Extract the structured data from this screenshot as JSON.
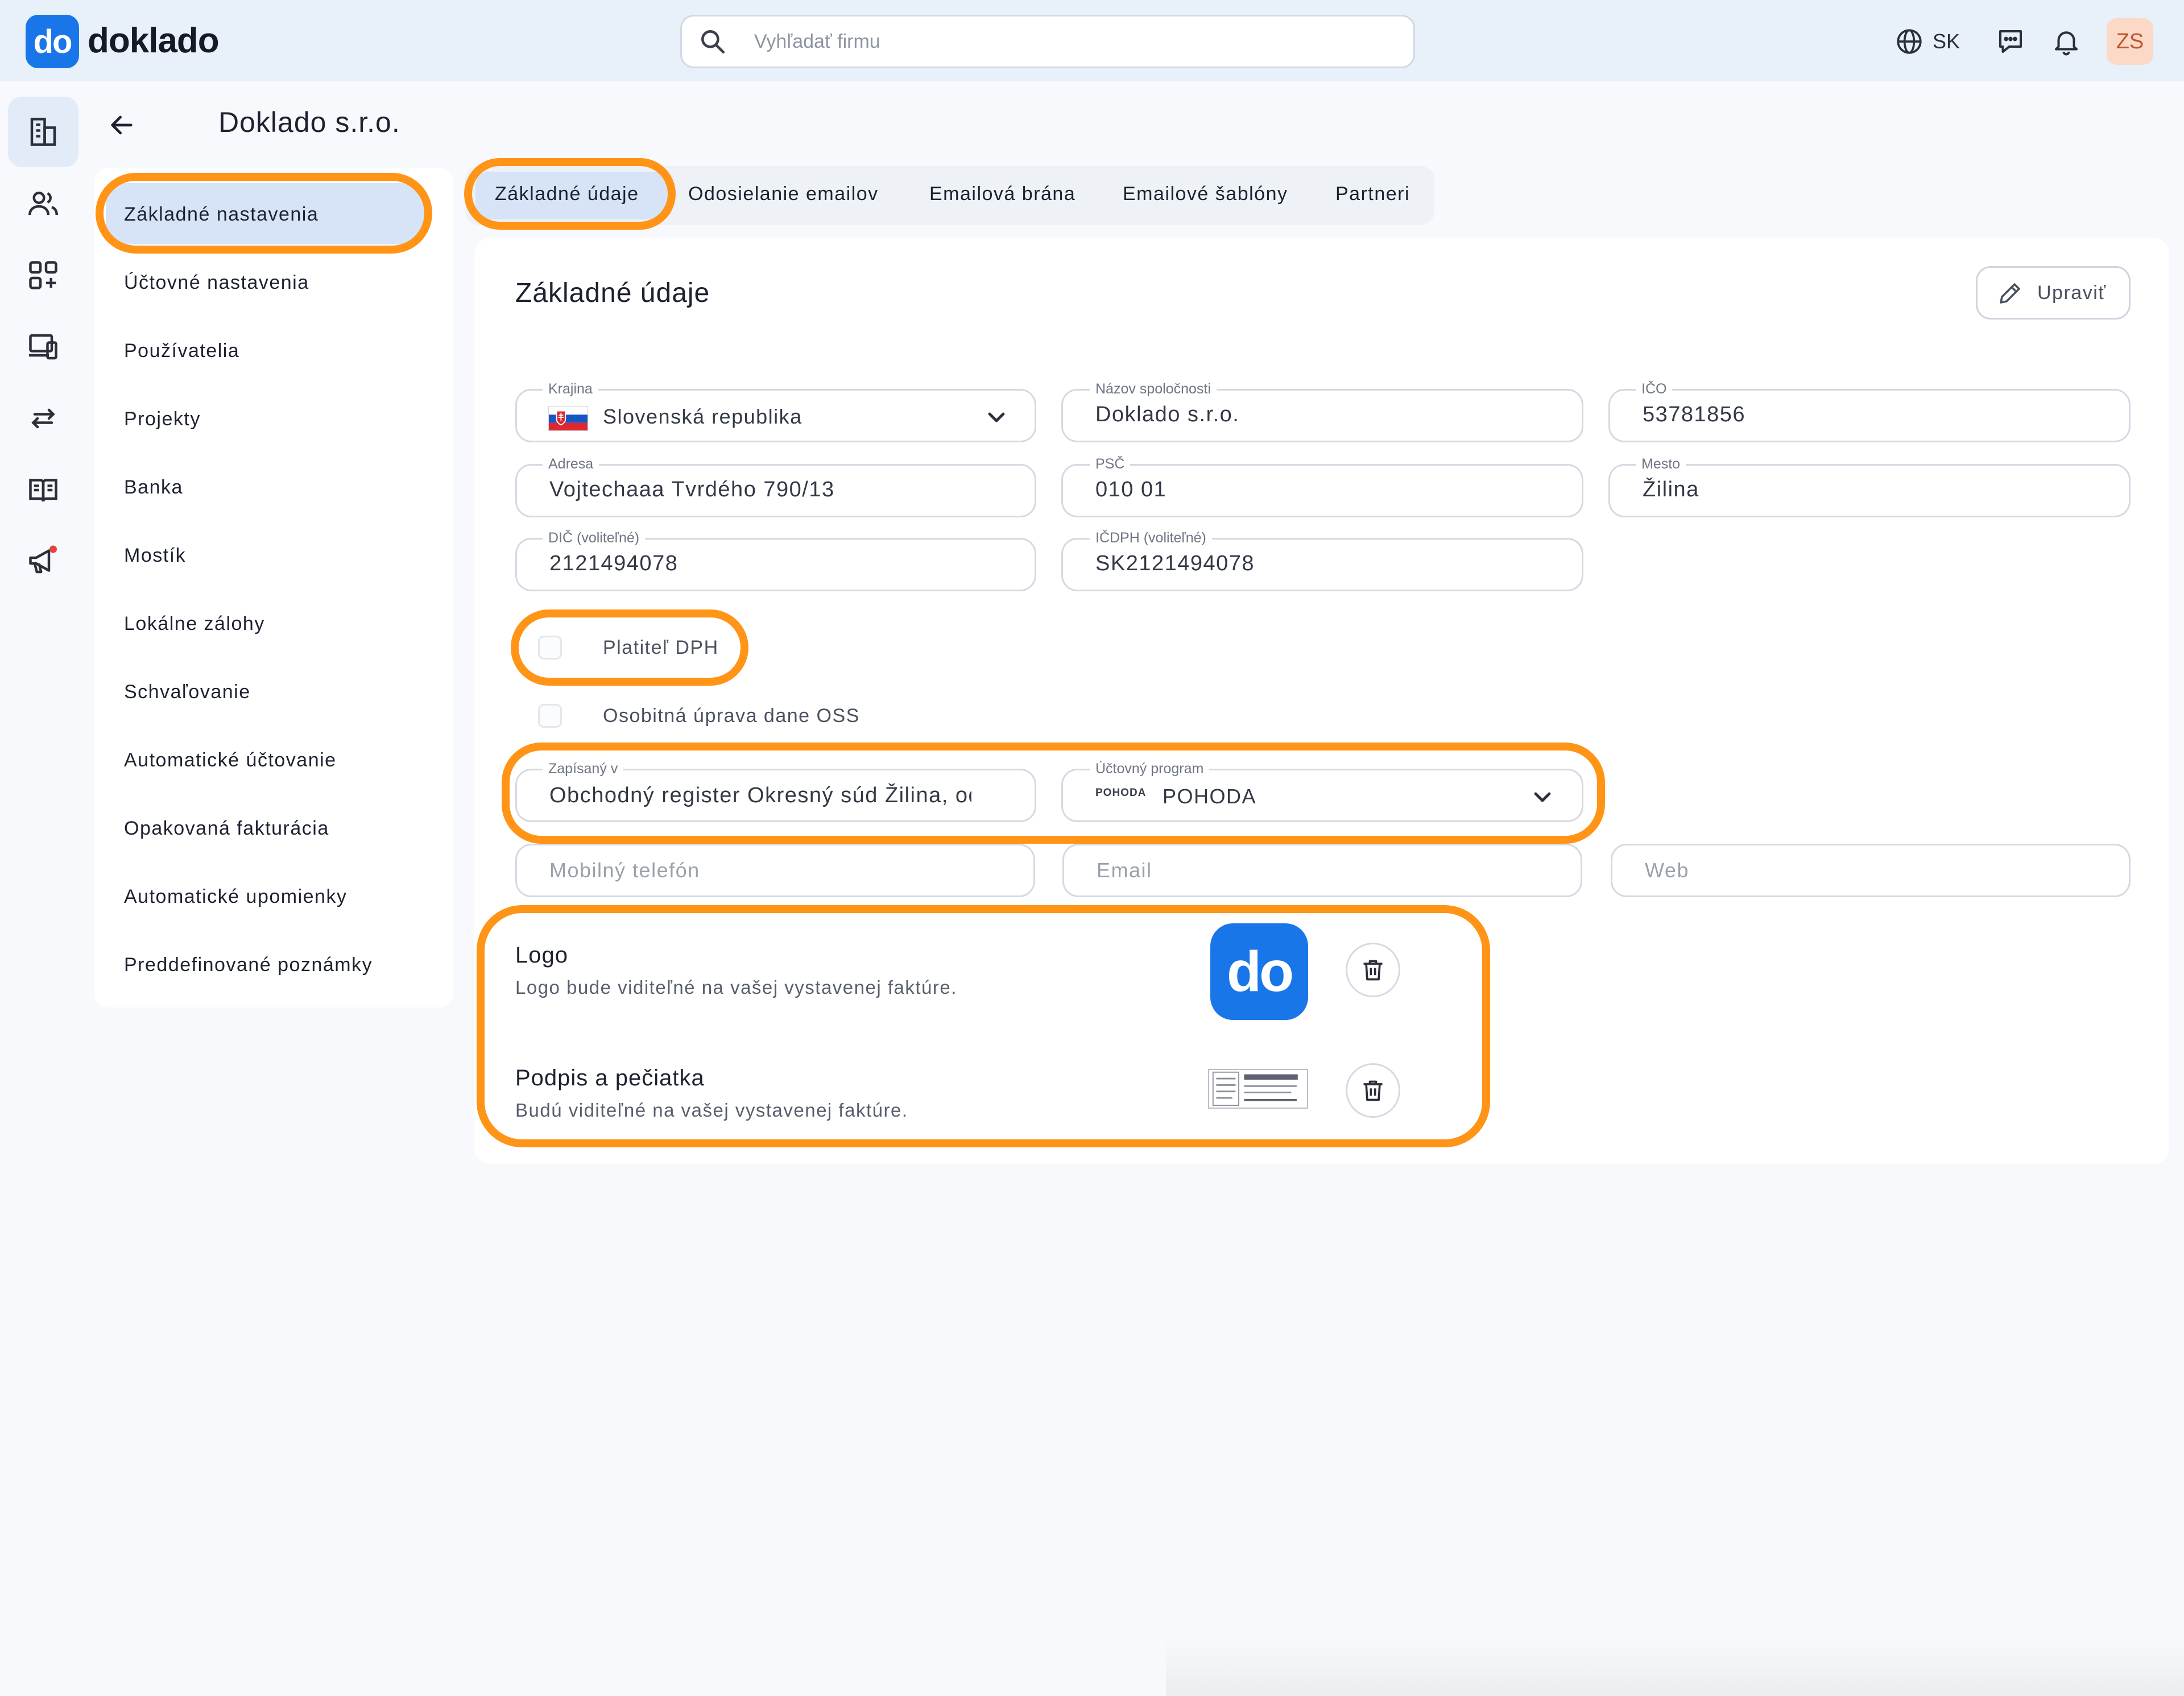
{
  "brand": {
    "badge": "do",
    "name": "doklado",
    "color": "#1976e8"
  },
  "search": {
    "placeholder": "Vyhľadať firmu"
  },
  "topbar": {
    "language": "SK",
    "avatar_initials": "ZS"
  },
  "rail": {
    "items": [
      "company-icon",
      "users-icon",
      "apps-icon",
      "devices-icon",
      "transfer-icon",
      "book-icon",
      "megaphone-icon"
    ]
  },
  "page": {
    "title": "Doklado s.r.o."
  },
  "sidebar": {
    "items": [
      {
        "label": "Základné nastavenia",
        "active": true
      },
      {
        "label": "Účtovné nastavenia"
      },
      {
        "label": "Používatelia"
      },
      {
        "label": "Projekty"
      },
      {
        "label": "Banka"
      },
      {
        "label": "Mostík"
      },
      {
        "label": "Lokálne zálohy"
      },
      {
        "label": "Schvaľovanie"
      },
      {
        "label": "Automatické účtovanie"
      },
      {
        "label": "Opakovaná fakturácia"
      },
      {
        "label": "Automatické upomienky"
      },
      {
        "label": "Preddefinované poznámky"
      }
    ]
  },
  "tabs": [
    {
      "label": "Základné údaje",
      "active": true
    },
    {
      "label": "Odosielanie emailov"
    },
    {
      "label": "Emailová brána"
    },
    {
      "label": "Emailové šablóny"
    },
    {
      "label": "Partneri"
    }
  ],
  "section": {
    "title": "Základné údaje",
    "edit_label": "Upraviť"
  },
  "form": {
    "country": {
      "label": "Krajina",
      "value": "Slovenská republika"
    },
    "company_name": {
      "label": "Názov spoločnosti",
      "value": "Doklado s.r.o."
    },
    "ico": {
      "label": "IČO",
      "value": "53781856"
    },
    "address": {
      "label": "Adresa",
      "value": "Vojtechaaa Tvrdého 790/13"
    },
    "psc": {
      "label": "PSČ",
      "value": "010 01"
    },
    "city": {
      "label": "Mesto",
      "value": "Žilina"
    },
    "dic": {
      "label": "DIČ (voliteľné)",
      "value": "2121494078"
    },
    "icdph": {
      "label": "IČDPH (voliteľné)",
      "value": "SK2121494078"
    },
    "vat_payer": {
      "label": "Platiteľ DPH",
      "checked": false
    },
    "oss": {
      "label": "Osobitná úprava dane OSS",
      "checked": false
    },
    "registered_in": {
      "label": "Zapísaný v",
      "value": "Obchodný register Okresný súd Žilina, oddiel: Sro"
    },
    "accounting_program": {
      "label": "Účtovný program",
      "value": "POHODA",
      "logo_text": "POHODA"
    },
    "mobile": {
      "placeholder": "Mobilný telefón"
    },
    "email": {
      "placeholder": "Email"
    },
    "web": {
      "placeholder": "Web"
    }
  },
  "assets": {
    "logo": {
      "title": "Logo",
      "subtitle": "Logo bude viditeľné na vašej vystavenej faktúre.",
      "image_text": "do"
    },
    "signature": {
      "title": "Podpis a pečiatka",
      "subtitle": "Budú viditeľné na vašej vystavenej faktúre."
    }
  },
  "highlight_color": "#ff9416"
}
